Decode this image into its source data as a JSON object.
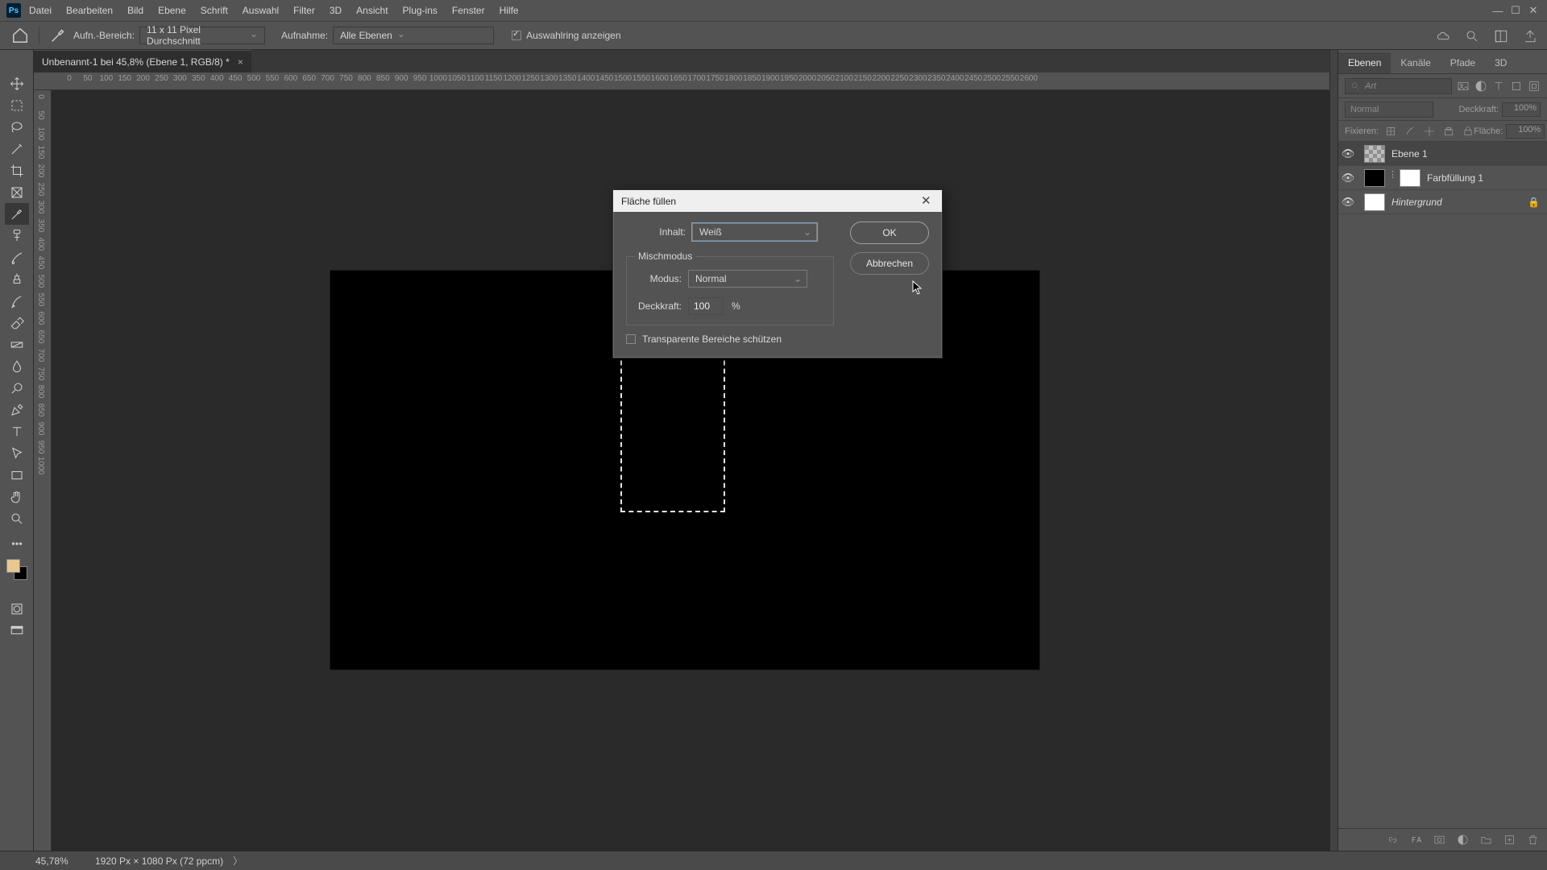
{
  "menu": {
    "items": [
      "Datei",
      "Bearbeiten",
      "Bild",
      "Ebene",
      "Schrift",
      "Auswahl",
      "Filter",
      "3D",
      "Ansicht",
      "Plug-ins",
      "Fenster",
      "Hilfe"
    ]
  },
  "options": {
    "range_label": "Aufn.-Bereich:",
    "range_value": "11 x 11 Pixel Durchschnitt",
    "sample_label": "Aufnahme:",
    "sample_value": "Alle Ebenen",
    "show_ring": "Auswahlring anzeigen"
  },
  "tab": {
    "title": "Unbenannt-1 bei 45,8% (Ebene 1, RGB/8) *"
  },
  "ruler": {
    "h_ticks": [
      "0",
      "50",
      "100",
      "150",
      "200",
      "250",
      "300",
      "350",
      "400",
      "450",
      "500",
      "550",
      "600",
      "650",
      "700",
      "750",
      "800",
      "850",
      "900",
      "950",
      "1000",
      "1050",
      "1100",
      "1150",
      "1200",
      "1250",
      "1300",
      "1350",
      "1400",
      "1450",
      "1500",
      "1550",
      "1600",
      "1650",
      "1700",
      "1750",
      "1800",
      "1850",
      "1900",
      "1950",
      "2000",
      "2050",
      "2100",
      "2150",
      "2200",
      "2250",
      "2300",
      "2350",
      "2400",
      "2450",
      "2500",
      "2550",
      "2600"
    ],
    "v_ticks": [
      "0",
      "50",
      "100",
      "150",
      "200",
      "250",
      "300",
      "350",
      "400",
      "450",
      "500",
      "550",
      "600",
      "650",
      "700",
      "750",
      "800",
      "850",
      "900",
      "950",
      "1000"
    ]
  },
  "status": {
    "zoom": "45,78%",
    "docinfo": "1920 Px × 1080 Px (72 ppcm)"
  },
  "dialog": {
    "title": "Fläche füllen",
    "content_label": "Inhalt:",
    "content_value": "Weiß",
    "blend_group": "Mischmodus",
    "mode_label": "Modus:",
    "mode_value": "Normal",
    "opacity_label": "Deckkraft:",
    "opacity_value": "100",
    "opacity_unit": "%",
    "preserve_trans": "Transparente Bereiche schützen",
    "ok": "OK",
    "cancel": "Abbrechen"
  },
  "panels": {
    "tabs": [
      "Ebenen",
      "Kanäle",
      "Pfade",
      "3D"
    ],
    "search_placeholder": "Art",
    "blend_mode": "Normal",
    "opacity_label": "Deckkraft:",
    "opacity_value": "100%",
    "lock_label": "Fixieren:",
    "fill_label": "Fläche:",
    "fill_value": "100%",
    "layers": [
      {
        "name": "Ebene 1",
        "visible": true,
        "thumbs": [
          "checker"
        ],
        "active": true
      },
      {
        "name": "Farbfüllung 1",
        "visible": true,
        "thumbs": [
          "black",
          "white"
        ],
        "link": true
      },
      {
        "name": "Hintergrund",
        "visible": true,
        "thumbs": [
          "white"
        ],
        "locked": true,
        "italic": true
      }
    ]
  }
}
